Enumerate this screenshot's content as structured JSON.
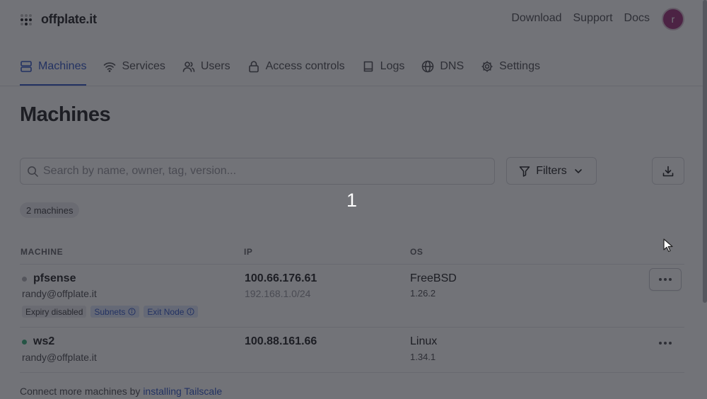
{
  "app": {
    "brand": "offplate.it"
  },
  "header": {
    "links": [
      "Download",
      "Support",
      "Docs"
    ],
    "avatar_initial": "r",
    "avatar_color": "#a0397e"
  },
  "tabs": [
    {
      "label": "Machines",
      "icon": "server-icon",
      "active": true
    },
    {
      "label": "Services",
      "icon": "wifi-icon",
      "active": false
    },
    {
      "label": "Users",
      "icon": "users-icon",
      "active": false
    },
    {
      "label": "Access controls",
      "icon": "lock-icon",
      "active": false
    },
    {
      "label": "Logs",
      "icon": "book-icon",
      "active": false
    },
    {
      "label": "DNS",
      "icon": "globe-icon",
      "active": false
    },
    {
      "label": "Settings",
      "icon": "gear-icon",
      "active": false
    }
  ],
  "page": {
    "title": "Machines"
  },
  "search": {
    "placeholder": "Search by name, owner, tag, version..."
  },
  "filters": {
    "label": "Filters"
  },
  "step_number": "1",
  "machine_count": "2 machines",
  "table": {
    "columns": [
      "MACHINE",
      "IP",
      "OS"
    ],
    "rows": [
      {
        "name": "pfsense",
        "status_color": "#b4b4b9",
        "owner": "randy@offplate.it",
        "tags": [
          {
            "label": "Expiry disabled",
            "style": "gray",
            "info": false
          },
          {
            "label": "Subnets",
            "style": "blue",
            "info": true
          },
          {
            "label": "Exit Node",
            "style": "blue",
            "info": true
          }
        ],
        "ip": "100.66.176.61",
        "ip_secondary": "192.168.1.0/24",
        "os": "FreeBSD",
        "version": "1.26.2"
      },
      {
        "name": "ws2",
        "status_color": "#3fb27f",
        "owner": "randy@offplate.it",
        "tags": [],
        "ip": "100.88.161.66",
        "ip_secondary": "",
        "os": "Linux",
        "version": "1.34.1"
      }
    ]
  },
  "footer": {
    "text": "Connect more machines by ",
    "link": "installing Tailscale"
  },
  "colors": {
    "accent": "#3a5ec9",
    "overlay": "rgba(20,22,30,0.6)"
  }
}
